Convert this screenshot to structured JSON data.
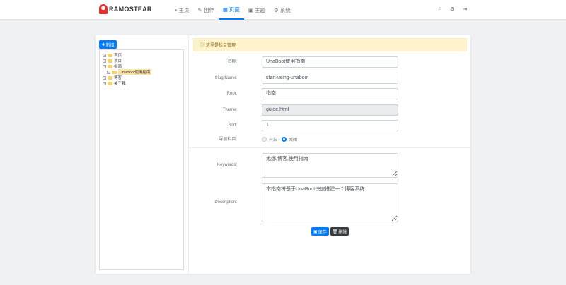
{
  "header": {
    "logo": "RAMOSTEAR",
    "nav": [
      {
        "label": "主页",
        "icon": "dashboard-icon"
      },
      {
        "label": "创作",
        "icon": "edit-icon"
      },
      {
        "label": "页面",
        "icon": "grid-icon",
        "active": true
      },
      {
        "label": "主题",
        "icon": "theme-icon"
      },
      {
        "label": "系统",
        "icon": "system-icon"
      }
    ],
    "right_icons": [
      "home-icon",
      "cogs-icon",
      "sign-out-icon"
    ]
  },
  "sidebar": {
    "new_label": "新增",
    "tree": [
      {
        "label": "首页"
      },
      {
        "label": "项目"
      },
      {
        "label": "指南"
      },
      {
        "label": "UnaBoot使用指南",
        "child": true,
        "selected": true
      },
      {
        "label": "博客"
      },
      {
        "label": "关于我"
      }
    ]
  },
  "form": {
    "alert": "这里是栏目管理",
    "name_label": "名称:",
    "name_value": "UnaBoot使用指南",
    "slug_label": "Slug Name:",
    "slug_value": "start-using-unaboot",
    "root_label": "Root:",
    "root_value": "指南",
    "theme_label": "Theme:",
    "theme_value": "guide.html",
    "sort_label": "Sort:",
    "sort_value": "1",
    "nav_label": "导航栏目:",
    "nav_on": "开启",
    "nav_off": "关闭",
    "nav_selected": "关闭",
    "keywords_label": "Keywords:",
    "keywords_value": "尤娜,博客,使用指南",
    "description_label": "Description:",
    "description_value": "本指南将基于UnaBoot快速搭建一个博客系统",
    "save_label": "保存",
    "delete_label": "删除"
  },
  "colors": {
    "primary": "#007bff",
    "dark": "#343a40",
    "alert_bg": "#fff3cd"
  }
}
